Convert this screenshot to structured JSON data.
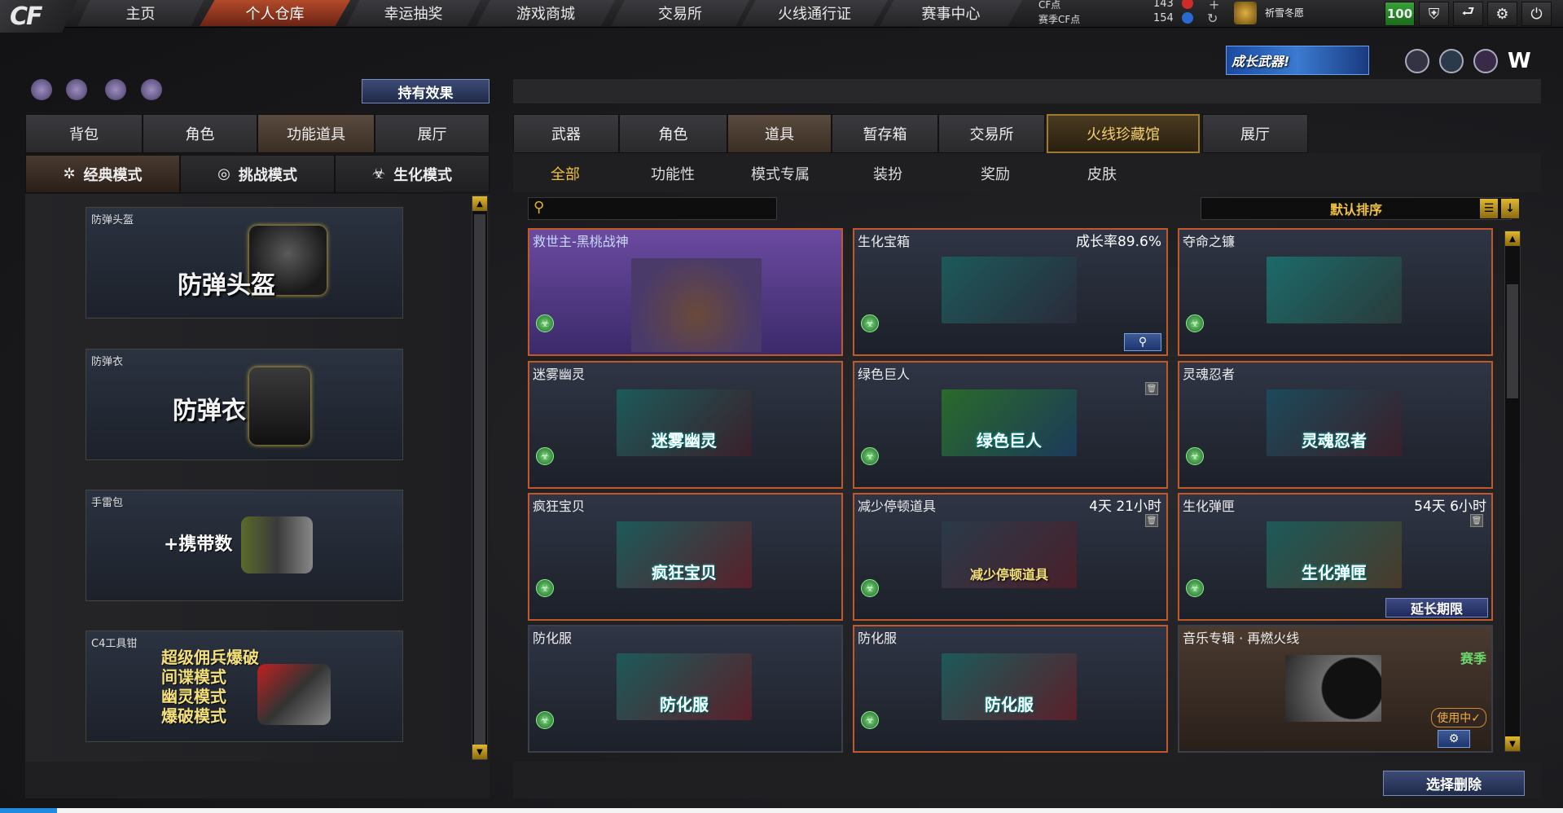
{
  "logo": "CF",
  "nav": {
    "tabs": [
      "主页",
      "个人仓库",
      "幸运抽奖",
      "游戏商城",
      "交易所",
      "火线通行证",
      "赛事中心"
    ],
    "active_index": 1
  },
  "currency": {
    "cf_label": "CF点",
    "cf_value": "143",
    "season_label": "赛季CF点",
    "season_value": "154"
  },
  "user": {
    "name": "祈雪冬愿",
    "level": "100"
  },
  "banner": {
    "text": "成长武器!"
  },
  "left": {
    "effect_button": "持有效果",
    "tabs": [
      "背包",
      "角色",
      "功能道具",
      "展厅"
    ],
    "active_tab": 2,
    "modes": [
      {
        "label": "经典模式",
        "icon": "star-burst-icon"
      },
      {
        "label": "挑战模式",
        "icon": "pulse-icon"
      },
      {
        "label": "生化模式",
        "icon": "biohazard-icon"
      }
    ],
    "items": [
      {
        "caption": "防弹头盔",
        "title": "防弹头盔"
      },
      {
        "caption": "防弹衣",
        "title": "防弹衣"
      },
      {
        "caption": "手雷包",
        "title": "+携带数"
      },
      {
        "caption": "C4工具钳",
        "lines": [
          "超级佣兵爆破",
          "间谍模式",
          "幽灵模式",
          "爆破模式"
        ]
      }
    ]
  },
  "right": {
    "tabs": [
      "武器",
      "角色",
      "道具",
      "暂存箱",
      "交易所",
      "火线珍藏馆",
      "展厅"
    ],
    "active_tab": 2,
    "gold_tab": 5,
    "subtabs": [
      "全部",
      "功能性",
      "模式专属",
      "装扮",
      "奖励",
      "皮肤"
    ],
    "active_subtab": 0,
    "search_placeholder": "",
    "sort_label": "默认排序",
    "cards": [
      {
        "name": "救世主-黑桃战神",
        "variant": "purple"
      },
      {
        "name": "生化宝箱",
        "right_text": "成长率89.6%"
      },
      {
        "name": "夺命之镰"
      },
      {
        "name": "迷雾幽灵",
        "picture_text": "迷雾幽灵"
      },
      {
        "name": "绿色巨人",
        "picture_text": "绿色巨人"
      },
      {
        "name": "灵魂忍者",
        "picture_text": "灵魂忍者"
      },
      {
        "name": "疯狂宝贝",
        "picture_text": "疯狂宝贝"
      },
      {
        "name": "减少停顿道具",
        "right_text": "4天 21小时",
        "picture_text": "减少停顿道具"
      },
      {
        "name": "生化弹匣",
        "right_text": "54天 6小时",
        "picture_text": "生化弹匣",
        "button": "延长期限"
      },
      {
        "name": "防化服",
        "picture_text": "防化服"
      },
      {
        "name": "防化服",
        "picture_text": "防化服"
      },
      {
        "name": "音乐专辑 · 再燃火线",
        "season": "赛季",
        "in_use": "使用中✓"
      }
    ],
    "delete_button": "选择删除"
  },
  "colors": {
    "accent_orange": "#c0582a",
    "gold": "#f0c040",
    "green": "#6cd66c"
  }
}
